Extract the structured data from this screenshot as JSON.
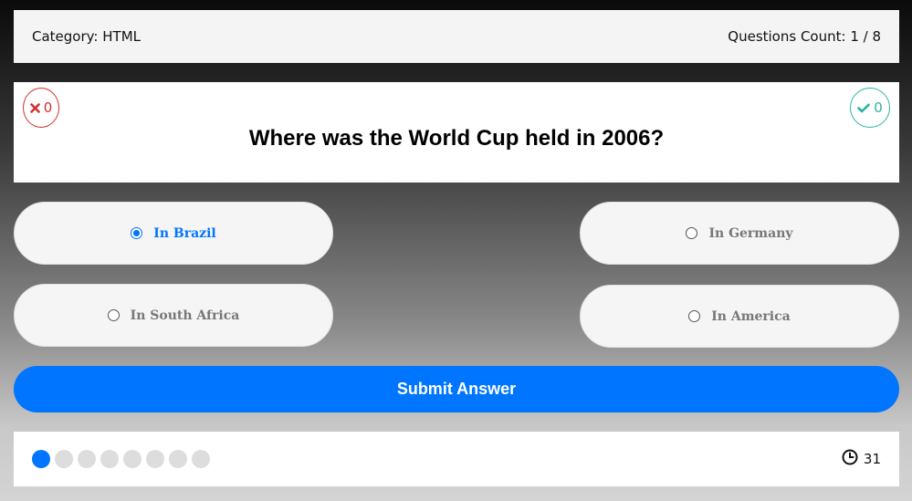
{
  "header": {
    "category": "Category: HTML",
    "count": "Questions Count: 1 / 8"
  },
  "question": {
    "text": "Where was the World Cup held in 2006?",
    "wrong_count": "0",
    "right_count": "0"
  },
  "options": [
    {
      "label": "In Brazil",
      "selected": true
    },
    {
      "label": "In Germany",
      "selected": false
    },
    {
      "label": "In South Africa",
      "selected": false
    },
    {
      "label": "In America",
      "selected": false
    }
  ],
  "submit_label": "Submit Answer",
  "progress": {
    "total": 8,
    "current": 1
  },
  "timer": {
    "value": "31",
    "icon": "clock-icon"
  },
  "colors": {
    "accent": "#0075ff",
    "wrong": "#d0312d",
    "right": "#2bb4a0",
    "bullet_inactive": "#dddddd"
  }
}
